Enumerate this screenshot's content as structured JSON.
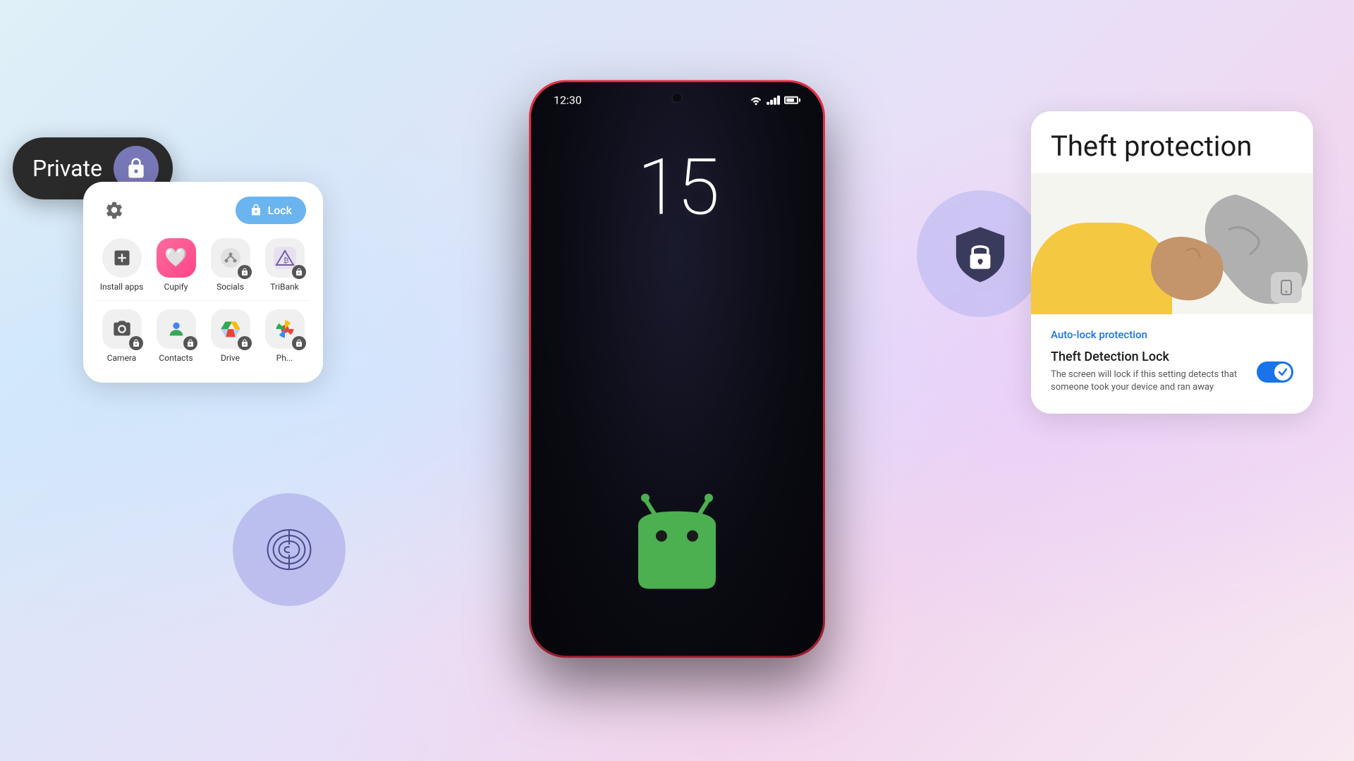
{
  "background": {
    "gradient_left": "#c8e8f8",
    "gradient_right": "#e8d0f8"
  },
  "phone": {
    "status_time": "12:30",
    "clock": "15",
    "signal": "signal-icon",
    "wifi": "wifi-icon",
    "battery": "battery-icon"
  },
  "private_card": {
    "label": "Private",
    "icon": "lock-icon"
  },
  "app_grid": {
    "lock_button": "Lock",
    "settings_icon": "settings-icon",
    "apps_row1": [
      {
        "name": "Install apps",
        "type": "install"
      },
      {
        "name": "Cupify",
        "type": "cupify"
      },
      {
        "name": "Socials",
        "type": "socials",
        "locked": true
      },
      {
        "name": "TriBank",
        "type": "tribank",
        "locked": true
      }
    ],
    "apps_row2": [
      {
        "name": "Camera",
        "type": "camera",
        "locked": true
      },
      {
        "name": "Contacts",
        "type": "contacts",
        "locked": true
      },
      {
        "name": "Drive",
        "type": "drive",
        "locked": true
      },
      {
        "name": "Photos",
        "type": "photos",
        "locked": true
      }
    ]
  },
  "theft_card": {
    "title": "Theft protection",
    "auto_lock_link": "Auto-lock protection",
    "detection_title": "Theft Detection Lock",
    "detection_desc": "The screen will lock if this setting detects that someone took your device and ran away",
    "toggle_enabled": true
  }
}
